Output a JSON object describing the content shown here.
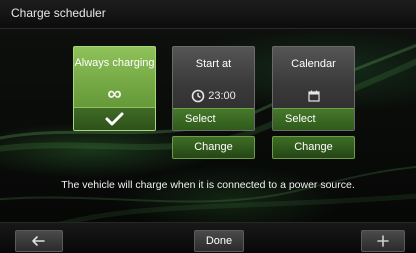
{
  "header": {
    "title": "Charge scheduler"
  },
  "options": [
    {
      "label": "Always charging",
      "icon": "infinity-icon",
      "symbol": "∞",
      "selected": true
    },
    {
      "label": "Start at",
      "icon": "clock-icon",
      "time": "23:00",
      "action_label": "Select",
      "change_label": "Change",
      "selected": false
    },
    {
      "label": "Calendar",
      "icon": "calendar-icon",
      "action_label": "Select",
      "change_label": "Change",
      "selected": false
    }
  ],
  "message": "The vehicle will charge when it is connected to a power source.",
  "footer": {
    "back_icon": "back-arrow-icon",
    "done_label": "Done",
    "add_icon": "plus-icon"
  },
  "colors": {
    "accent": "#7bb24a",
    "accent_dark": "#2f5b1b"
  }
}
